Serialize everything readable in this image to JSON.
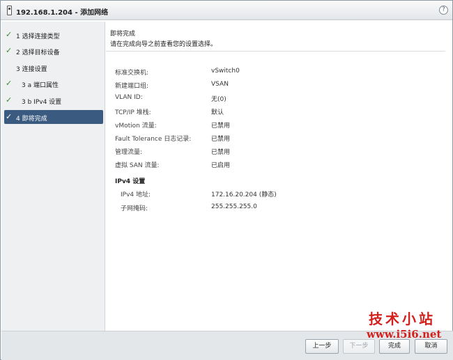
{
  "window": {
    "title": "192.168.1.204 - 添加网络",
    "help_label": "?"
  },
  "sidebar": {
    "steps": [
      {
        "label": "1  选择连接类型",
        "check": "✓"
      },
      {
        "label": "2  选择目标设备",
        "check": "✓"
      },
      {
        "label": "3  连接设置",
        "check": ""
      },
      {
        "label": "3 a  端口属性",
        "check": "✓"
      },
      {
        "label": "3 b  IPv4 设置",
        "check": "✓"
      },
      {
        "label": "4  即将完成",
        "check": "✓"
      }
    ]
  },
  "content": {
    "title": "即将完成",
    "subtitle": "请在完成向导之前查看您的设置选择。",
    "settings": [
      {
        "key": "标准交换机:",
        "value": "vSwitch0"
      },
      {
        "key": "新建端口组:",
        "value": "VSAN"
      },
      {
        "key": "VLAN ID:",
        "value": "无(0)"
      },
      {
        "key": "TCP/IP 堆栈:",
        "value": "默认"
      },
      {
        "key": "vMotion 流量:",
        "value": "已禁用"
      },
      {
        "key": "Fault Tolerance 日志记录:",
        "value": "已禁用"
      },
      {
        "key": "管理流量:",
        "value": "已禁用"
      },
      {
        "key": "虚拟 SAN 流量:",
        "value": "已启用"
      }
    ],
    "ipv4_heading": "IPv4 设置",
    "ipv4": [
      {
        "key": "IPv4 地址:",
        "value": "172.16.20.204 (静态)"
      },
      {
        "key": "子网掩码:",
        "value": "255.255.255.0"
      }
    ]
  },
  "footer": {
    "back_label": "上一步",
    "next_label": "下一步",
    "finish_label": "完成",
    "cancel_label": "取消"
  },
  "watermark": {
    "name": "技术小站",
    "url": "www.i5i6.net"
  }
}
